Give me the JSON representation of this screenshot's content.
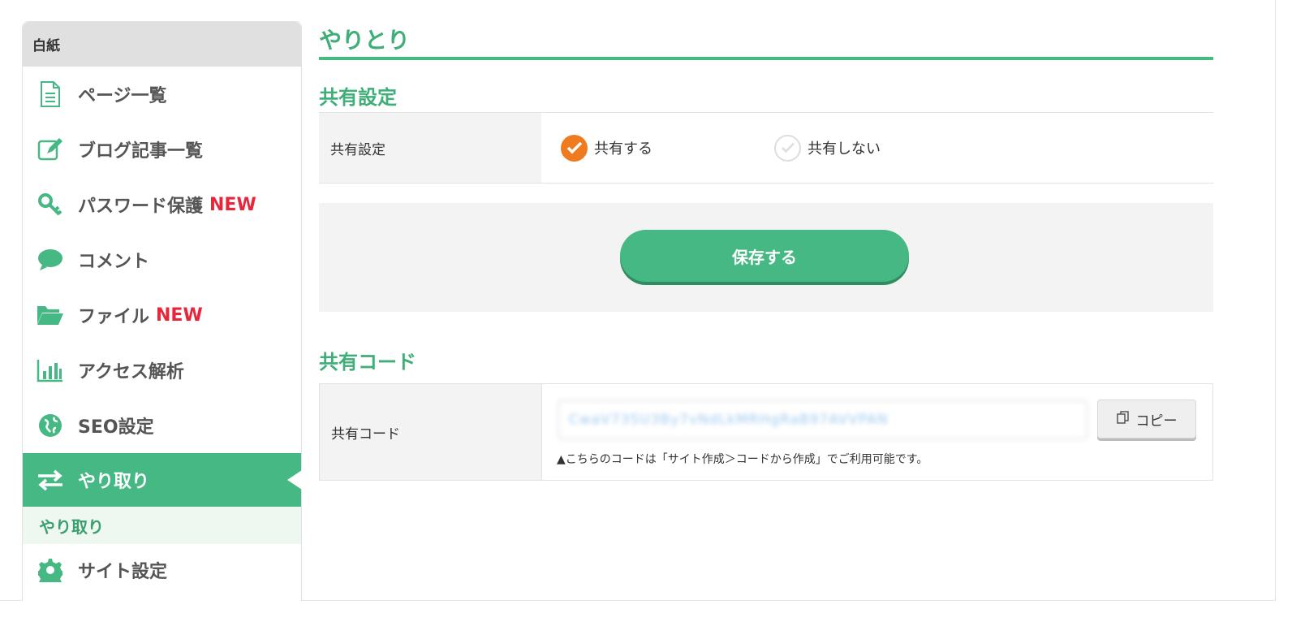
{
  "sidebar": {
    "header": "白紙",
    "items": [
      {
        "label": "ページ一覧",
        "icon": "document-icon",
        "badge": ""
      },
      {
        "label": "ブログ記事一覧",
        "icon": "edit-icon",
        "badge": ""
      },
      {
        "label": "パスワード保護",
        "icon": "key-icon",
        "badge": "NEW"
      },
      {
        "label": "コメント",
        "icon": "comment-icon",
        "badge": ""
      },
      {
        "label": "ファイル",
        "icon": "folder-icon",
        "badge": "NEW"
      },
      {
        "label": "アクセス解析",
        "icon": "bar-chart-icon",
        "badge": ""
      },
      {
        "label": "SEO設定",
        "icon": "globe-icon",
        "badge": ""
      },
      {
        "label": "やり取り",
        "icon": "swap-arrows-icon",
        "badge": ""
      },
      {
        "label": "サイト設定",
        "icon": "gear-icon",
        "badge": ""
      }
    ],
    "active_sub": "やり取り"
  },
  "main": {
    "title": "やりとり",
    "share_settings": {
      "section_title": "共有設定",
      "row_label": "共有設定",
      "option_on": "共有する",
      "option_off": "共有しない",
      "selected": "共有する"
    },
    "save_button": "保存する",
    "share_code": {
      "section_title": "共有コード",
      "row_label": "共有コード",
      "code_value": "CwaV735U3By7vNdLkMRHgRaB97AVVPAN",
      "copy_button": "コピー",
      "note": "▲こちらのコードは「サイト作成＞コードから作成」でご利用可能です。"
    }
  },
  "colors": {
    "accent": "#45b884",
    "new_badge": "#e8253a",
    "radio_on": "#ef7b1e"
  }
}
